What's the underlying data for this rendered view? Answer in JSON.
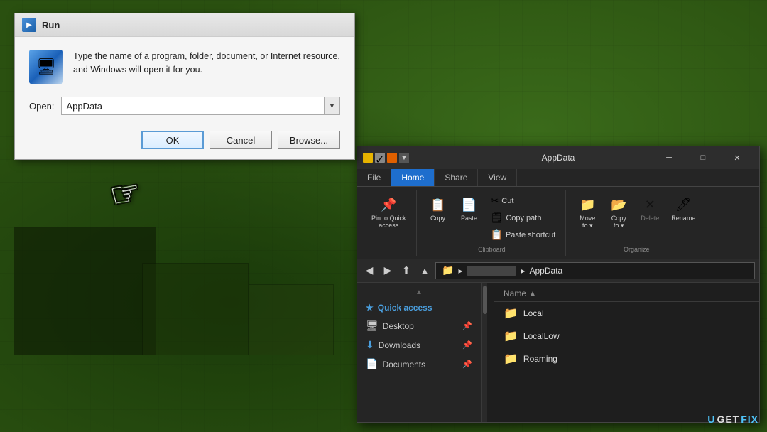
{
  "background": {
    "color": "#2a5010"
  },
  "run_dialog": {
    "title": "Run",
    "description": "Type the name of a program, folder, document, or Internet resource, and Windows will open it for you.",
    "open_label": "Open:",
    "input_value": "AppData",
    "input_placeholder": "AppData",
    "btn_ok": "OK",
    "btn_cancel": "Cancel",
    "btn_browse": "Browse..."
  },
  "explorer": {
    "title": "AppData",
    "tabs": {
      "file": "File",
      "home": "Home",
      "share": "Share",
      "view": "View"
    },
    "ribbon": {
      "pin_label": "Pin to Quick\naccess",
      "copy_label": "Copy",
      "paste_label": "Paste",
      "cut_label": "Cut",
      "copy_path_label": "Copy path",
      "paste_shortcut_label": "Paste shortcut",
      "move_to_label": "Move\nto",
      "copy_to_label": "Copy\nto",
      "delete_label": "Delete",
      "rename_label": "Rename",
      "clipboard_group": "Clipboard",
      "organize_group": "Organize"
    },
    "address": {
      "path": "AppData",
      "breadcrumb": "▸ AppData"
    },
    "sidebar": {
      "quick_access_label": "Quick access",
      "desktop_label": "Desktop",
      "downloads_label": "Downloads",
      "documents_label": "Documents"
    },
    "file_list": {
      "column_name": "Name",
      "column_sort": "▲",
      "files": [
        {
          "name": "Local",
          "icon": "📁"
        },
        {
          "name": "LocalLow",
          "icon": "📁"
        },
        {
          "name": "Roaming",
          "icon": "📁"
        }
      ]
    }
  },
  "watermark": {
    "text": "UGETFIX"
  },
  "window_controls": {
    "minimize": "─",
    "maximize": "□",
    "close": "✕"
  }
}
